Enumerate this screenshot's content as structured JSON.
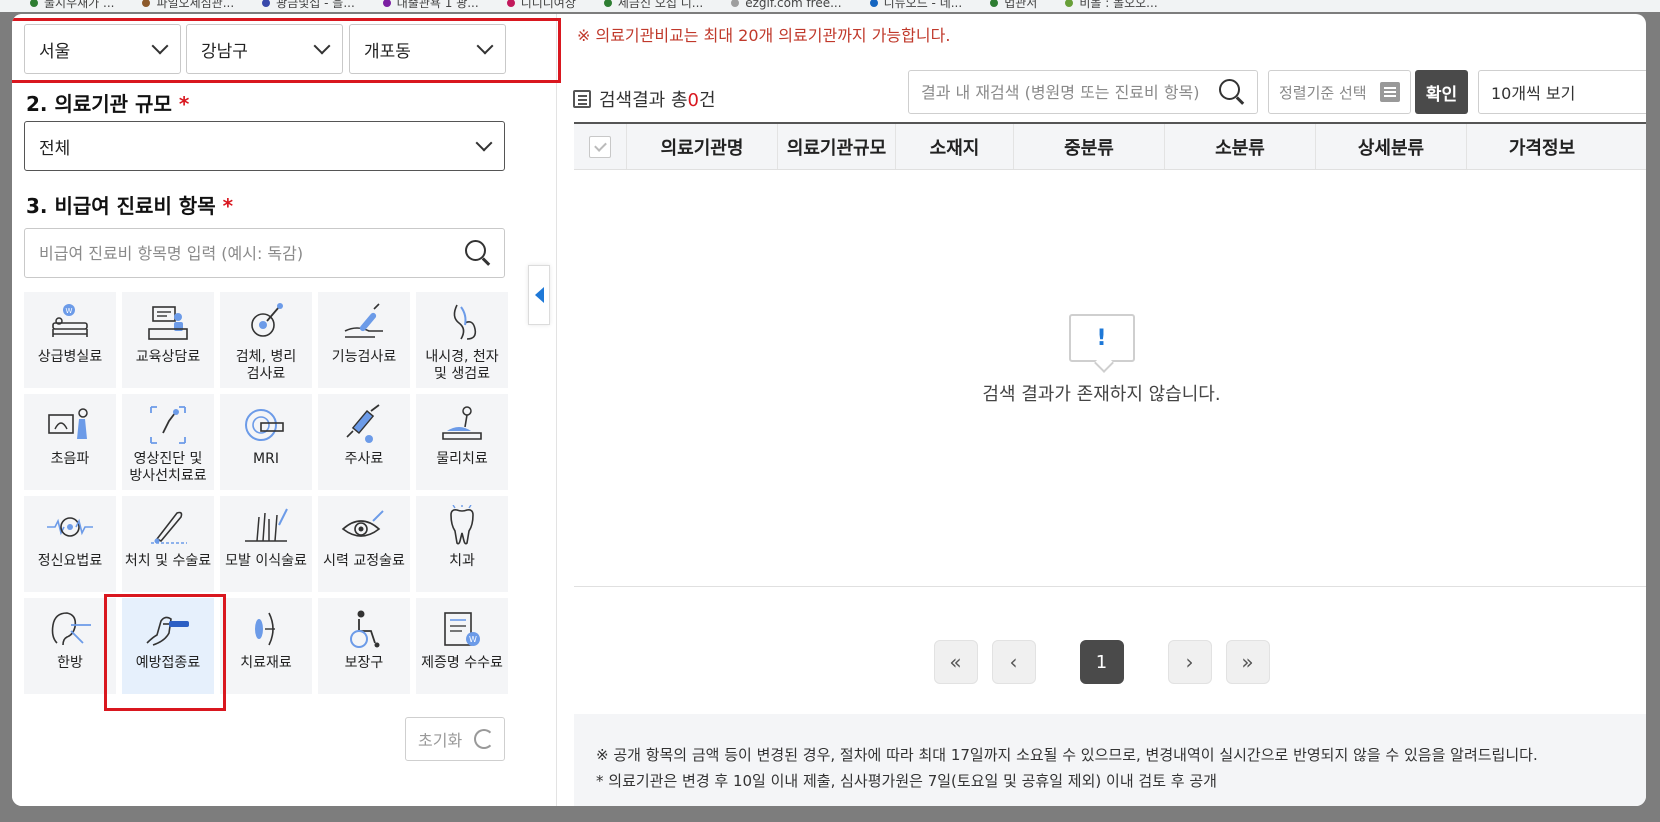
{
  "bookmarks": [
    {
      "label": "물지우재가 ...",
      "color": "#2e7d32"
    },
    {
      "label": "파일오세심관...",
      "color": "#8d5a2b"
    },
    {
      "label": "광금및섭 - 을...",
      "color": "#3949ab"
    },
    {
      "label": "대출관욕 1 광...",
      "color": "#7b1fa2"
    },
    {
      "label": "디디디여상",
      "color": "#c2185b"
    },
    {
      "label": "세금신 오섭 디...",
      "color": "#2e7d32"
    },
    {
      "label": "ezgif.com free...",
      "color": "#9e9e9e"
    },
    {
      "label": "디뉴오드 - 네...",
      "color": "#1565c0"
    },
    {
      "label": "법관서",
      "color": "#2e7d32"
    },
    {
      "label": "비볼 : 볼오오...",
      "color": "#689f38"
    }
  ],
  "region": {
    "city": "서울",
    "district": "강남구",
    "dong": "개포동"
  },
  "scale_section": {
    "title": "2. 의료기관 규모",
    "required_mark": "*",
    "selected": "전체"
  },
  "items_section": {
    "title": "3. 비급여 진료비 항목",
    "required_mark": "*",
    "search_placeholder": "비급여 진료비 항목명 입력 (예시: 독감)"
  },
  "categories": [
    {
      "label": "상급병실료",
      "icon": "hospital-bed-icon"
    },
    {
      "label": "교육상담료",
      "icon": "consultation-desk-icon"
    },
    {
      "label": "검체, 병리\n검사료",
      "icon": "specimen-test-icon"
    },
    {
      "label": "기능검사료",
      "icon": "function-test-icon"
    },
    {
      "label": "내시경, 천자\n및 생검료",
      "icon": "endoscope-icon"
    },
    {
      "label": "초음파",
      "icon": "ultrasound-icon"
    },
    {
      "label": "영상진단 및\n방사선치료료",
      "icon": "xray-icon"
    },
    {
      "label": "MRI",
      "icon": "mri-icon"
    },
    {
      "label": "주사료",
      "icon": "syringe-icon"
    },
    {
      "label": "물리치료",
      "icon": "physical-therapy-icon"
    },
    {
      "label": "정신요법료",
      "icon": "brain-wave-icon"
    },
    {
      "label": "처치 및 수술료",
      "icon": "surgery-icon"
    },
    {
      "label": "모발 이식술료",
      "icon": "hair-transplant-icon"
    },
    {
      "label": "시력 교정술료",
      "icon": "eye-icon"
    },
    {
      "label": "치과",
      "icon": "tooth-icon"
    },
    {
      "label": "한방",
      "icon": "acupuncture-ear-icon"
    },
    {
      "label": "예방접종료",
      "icon": "vaccine-injection-icon",
      "selected": true
    },
    {
      "label": "치료재료",
      "icon": "treatment-material-icon"
    },
    {
      "label": "보장구",
      "icon": "wheelchair-icon"
    },
    {
      "label": "제증명 수수료",
      "icon": "certificate-document-icon"
    }
  ],
  "reset_label": "초기화",
  "results": {
    "notice": "※ 의료기관비교는 최대 20개 의료기관까지 가능합니다.",
    "count_prefix": "검색결과 총",
    "count": "0",
    "count_suffix": "건",
    "research_placeholder": "결과 내 재검색 (병원명 또는 진료비 항목)",
    "sort_placeholder": "정렬기준 선택",
    "confirm_label": "확인",
    "per_page": "10개씩 보기",
    "columns": [
      "의료기관명",
      "의료기관규모",
      "소재지",
      "중분류",
      "소분류",
      "상세분류",
      "가격정보"
    ],
    "empty_mark": "!",
    "empty_message": "검색 결과가 존재하지 않습니다.",
    "pagination": {
      "current": "1"
    },
    "footer_line1": "※ 공개 항목의 금액 등이 변경된 경우, 절차에 따라 최대 17일까지 소요될 수 있으므로, 변경내역이 실시간으로 반영되지 않을 수 있음을 알려드립니다.",
    "footer_line2": "* 의료기관은 변경 후 10일 이내 제출, 심사평가원은 7일(토요일 및 공휴일 제외) 이내 검토 후 공개"
  },
  "colors": {
    "accent_red": "#d9171f",
    "accent_blue": "#1e78d7",
    "dark_button": "#4a4a4a"
  }
}
